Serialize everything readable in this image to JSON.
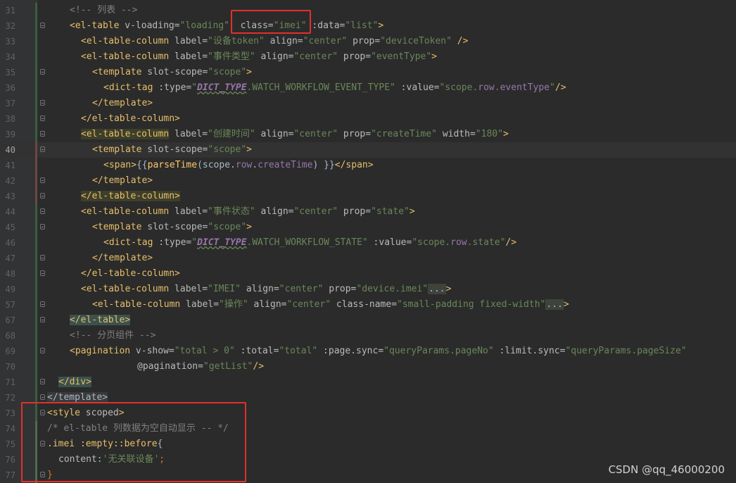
{
  "editor": {
    "lines": [
      {
        "num": "31",
        "parts": [
          {
            "t": "<!-- 列表 -->",
            "c": "cm"
          }
        ]
      },
      {
        "num": "32",
        "parts": [
          {
            "t": "<",
            "c": "tg"
          },
          {
            "t": "el-table",
            "c": "tg"
          },
          {
            "t": " v-loading=",
            "c": "at"
          },
          {
            "t": "\"loading\"",
            "c": "sv"
          },
          {
            "t": "  class=",
            "c": "at"
          },
          {
            "t": "\"imei\"",
            "c": "sv"
          },
          {
            "t": " :data=",
            "c": "at"
          },
          {
            "t": "\"list\"",
            "c": "sv"
          },
          {
            "t": ">",
            "c": "tg"
          }
        ]
      },
      {
        "num": "33",
        "parts": [
          {
            "t": "<el-table-column",
            "c": "tg"
          },
          {
            "t": " label=",
            "c": "at"
          },
          {
            "t": "\"设备token\"",
            "c": "sv"
          },
          {
            "t": " align=",
            "c": "at"
          },
          {
            "t": "\"center\"",
            "c": "sv"
          },
          {
            "t": " prop=",
            "c": "at"
          },
          {
            "t": "\"deviceToken\"",
            "c": "sv"
          },
          {
            "t": " />",
            "c": "tg"
          }
        ]
      },
      {
        "num": "34",
        "parts": [
          {
            "t": "<el-table-column",
            "c": "tg"
          },
          {
            "t": " label=",
            "c": "at"
          },
          {
            "t": "\"事件类型\"",
            "c": "sv"
          },
          {
            "t": " align=",
            "c": "at"
          },
          {
            "t": "\"center\"",
            "c": "sv"
          },
          {
            "t": " prop=",
            "c": "at"
          },
          {
            "t": "\"eventType\"",
            "c": "sv"
          },
          {
            "t": ">",
            "c": "tg"
          }
        ]
      },
      {
        "num": "35",
        "parts": [
          {
            "t": "<template",
            "c": "tg"
          },
          {
            "t": " slot-scope=",
            "c": "at"
          },
          {
            "t": "\"scope\"",
            "c": "sv"
          },
          {
            "t": ">",
            "c": "tg"
          }
        ]
      },
      {
        "num": "36",
        "parts": [
          {
            "t": "<dict-tag",
            "c": "tg"
          },
          {
            "t": " :type=",
            "c": "at"
          },
          {
            "t": "\"",
            "c": "sv"
          },
          {
            "t": "DICT_TYPE",
            "c": "ck"
          },
          {
            "t": ".WATCH_WORKFLOW_EVENT_TYPE\"",
            "c": "sv"
          },
          {
            "t": " :value=",
            "c": "at"
          },
          {
            "t": "\"scope.",
            "c": "sv"
          },
          {
            "t": "row",
            "c": "pr"
          },
          {
            "t": ".",
            "c": "sv"
          },
          {
            "t": "eventType",
            "c": "pr"
          },
          {
            "t": "\"",
            "c": "sv"
          },
          {
            "t": "/>",
            "c": "tg"
          }
        ]
      },
      {
        "num": "37",
        "parts": [
          {
            "t": "</template>",
            "c": "tg"
          }
        ]
      },
      {
        "num": "38",
        "parts": [
          {
            "t": "</el-table-column>",
            "c": "tg"
          }
        ]
      },
      {
        "num": "39",
        "parts": [
          {
            "t": "<el-table-column",
            "c": "tg hl-tag2"
          },
          {
            "t": " label=",
            "c": "at"
          },
          {
            "t": "\"创建时间\"",
            "c": "sv"
          },
          {
            "t": " align=",
            "c": "at"
          },
          {
            "t": "\"center\"",
            "c": "sv"
          },
          {
            "t": " prop=",
            "c": "at"
          },
          {
            "t": "\"createTime\"",
            "c": "sv"
          },
          {
            "t": " width=",
            "c": "at"
          },
          {
            "t": "\"180\"",
            "c": "sv"
          },
          {
            "t": ">",
            "c": "tg"
          }
        ]
      },
      {
        "num": "40",
        "parts": [
          {
            "t": "<template",
            "c": "tg"
          },
          {
            "t": " slot-scope=",
            "c": "at"
          },
          {
            "t": "\"scope\"",
            "c": "sv"
          },
          {
            "t": ">",
            "c": "tg"
          }
        ]
      },
      {
        "num": "41",
        "parts": [
          {
            "t": "<span>",
            "c": "tg"
          },
          {
            "t": "{{",
            "c": "pt"
          },
          {
            "t": "parseTime",
            "c": "fn"
          },
          {
            "t": "(scope.",
            "c": "pt"
          },
          {
            "t": "row",
            "c": "pr"
          },
          {
            "t": ".",
            "c": "pt"
          },
          {
            "t": "createTime",
            "c": "pr"
          },
          {
            "t": ") ",
            "c": "pt"
          },
          {
            "t": "}}",
            "c": "pt"
          },
          {
            "t": "</span>",
            "c": "tg"
          }
        ]
      },
      {
        "num": "42",
        "parts": [
          {
            "t": "</template>",
            "c": "tg"
          }
        ]
      },
      {
        "num": "43",
        "parts": [
          {
            "t": "</el-table-column>",
            "c": "tg hl-tag2"
          }
        ]
      },
      {
        "num": "44",
        "parts": [
          {
            "t": "<el-table-column",
            "c": "tg"
          },
          {
            "t": " label=",
            "c": "at"
          },
          {
            "t": "\"事件状态\"",
            "c": "sv"
          },
          {
            "t": " align=",
            "c": "at"
          },
          {
            "t": "\"center\"",
            "c": "sv"
          },
          {
            "t": " prop=",
            "c": "at"
          },
          {
            "t": "\"state\"",
            "c": "sv"
          },
          {
            "t": ">",
            "c": "tg"
          }
        ]
      },
      {
        "num": "45",
        "parts": [
          {
            "t": "<template",
            "c": "tg"
          },
          {
            "t": " slot-scope=",
            "c": "at"
          },
          {
            "t": "\"scope\"",
            "c": "sv"
          },
          {
            "t": ">",
            "c": "tg"
          }
        ]
      },
      {
        "num": "46",
        "parts": [
          {
            "t": "<dict-tag",
            "c": "tg"
          },
          {
            "t": " :type=",
            "c": "at"
          },
          {
            "t": "\"",
            "c": "sv"
          },
          {
            "t": "DICT_TYPE",
            "c": "ck"
          },
          {
            "t": ".WATCH_WORKFLOW_STATE\"",
            "c": "sv"
          },
          {
            "t": " :value=",
            "c": "at"
          },
          {
            "t": "\"scope.",
            "c": "sv"
          },
          {
            "t": "row",
            "c": "pr"
          },
          {
            "t": ".state\"",
            "c": "sv"
          },
          {
            "t": "/>",
            "c": "tg"
          }
        ]
      },
      {
        "num": "47",
        "parts": [
          {
            "t": "</template>",
            "c": "tg"
          }
        ]
      },
      {
        "num": "48",
        "parts": [
          {
            "t": "</el-table-column>",
            "c": "tg"
          }
        ]
      },
      {
        "num": "49",
        "parts": [
          {
            "t": "<el-table-column",
            "c": "tg"
          },
          {
            "t": " label=",
            "c": "at"
          },
          {
            "t": "\"IMEI\"",
            "c": "sv"
          },
          {
            "t": " align=",
            "c": "at"
          },
          {
            "t": "\"center\"",
            "c": "sv"
          },
          {
            "t": " prop=",
            "c": "at"
          },
          {
            "t": "\"device.imei\"",
            "c": "sv"
          },
          {
            "t": "...",
            "c": "pill"
          },
          {
            "t": ">",
            "c": "tg"
          }
        ]
      },
      {
        "num": "57",
        "parts": [
          {
            "t": "<el-table-column",
            "c": "tg"
          },
          {
            "t": " label=",
            "c": "at"
          },
          {
            "t": "\"操作\"",
            "c": "sv"
          },
          {
            "t": " align=",
            "c": "at"
          },
          {
            "t": "\"center\"",
            "c": "sv"
          },
          {
            "t": " class-name=",
            "c": "at"
          },
          {
            "t": "\"small-padding fixed-width\"",
            "c": "sv"
          },
          {
            "t": "...",
            "c": "pill"
          },
          {
            "t": ">",
            "c": "tg"
          }
        ]
      },
      {
        "num": "67",
        "parts": [
          {
            "t": "</el-table>",
            "c": "tg hl-tag"
          }
        ]
      },
      {
        "num": "68",
        "parts": [
          {
            "t": "<!-- 分页组件 -->",
            "c": "cm"
          }
        ]
      },
      {
        "num": "69",
        "parts": [
          {
            "t": "<pagination",
            "c": "tg"
          },
          {
            "t": " v-show=",
            "c": "at"
          },
          {
            "t": "\"total > 0\"",
            "c": "sv"
          },
          {
            "t": " :total=",
            "c": "at"
          },
          {
            "t": "\"total\"",
            "c": "sv"
          },
          {
            "t": " :page.sync=",
            "c": "at"
          },
          {
            "t": "\"queryParams.pageNo\"",
            "c": "sv"
          },
          {
            "t": " :limit.sync=",
            "c": "at"
          },
          {
            "t": "\"queryParams.pageSize\"",
            "c": "sv"
          }
        ]
      },
      {
        "num": "70",
        "parts": [
          {
            "t": "@pagination=",
            "c": "at"
          },
          {
            "t": "\"getList\"",
            "c": "sv"
          },
          {
            "t": "/>",
            "c": "tg"
          }
        ]
      },
      {
        "num": "71",
        "parts": [
          {
            "t": "</div>",
            "c": "tg hl-tag"
          }
        ]
      },
      {
        "num": "72",
        "parts": [
          {
            "t": "</template>",
            "c": "tg dim"
          }
        ]
      },
      {
        "num": "73",
        "parts": [
          {
            "t": "<style",
            "c": "tg"
          },
          {
            "t": " scoped",
            "c": "at"
          },
          {
            "t": ">",
            "c": "tg"
          }
        ]
      },
      {
        "num": "74",
        "parts": [
          {
            "t": "/* el-table 列数据为空自动显示 -- */",
            "c": "cm"
          }
        ]
      },
      {
        "num": "75",
        "parts": [
          {
            "t": ".imei ",
            "c": "sel"
          },
          {
            "t": ":empty::before",
            "c": "sel"
          },
          {
            "t": "{",
            "c": "pt"
          }
        ]
      },
      {
        "num": "76",
        "parts": [
          {
            "t": "content",
            "c": "cssprop"
          },
          {
            "t": ":",
            "c": "pt"
          },
          {
            "t": "'无关联设备'",
            "c": "cssstr"
          },
          {
            "t": ";",
            "c": "kw"
          }
        ]
      },
      {
        "num": "77",
        "parts": [
          {
            "t": "}",
            "c": "kw"
          }
        ]
      }
    ]
  },
  "watermark": "CSDN @qq_46000200",
  "colors": {
    "highlight_box": "#e3302b",
    "background": "#2b2b2b",
    "gutter": "#313335"
  }
}
